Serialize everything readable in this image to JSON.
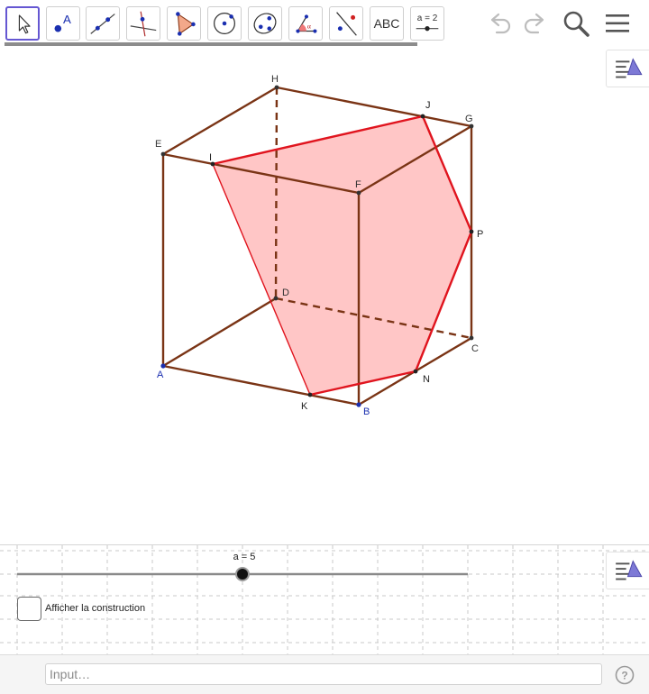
{
  "toolbar": {
    "text_tool_label": "ABC",
    "slider_tool_label": "a = 2",
    "point_tool_label": "A"
  },
  "graphics": {
    "vertices": {
      "A": "A",
      "B": "B",
      "C": "C",
      "D": "D",
      "E": "E",
      "F": "F",
      "G": "G",
      "H": "H",
      "I": "I",
      "J": "J",
      "K": "K",
      "N": "N",
      "P": "P"
    },
    "colors": {
      "cube_edges": "#7a3415",
      "section_edges": "#e0141e",
      "section_fill": "#ffbcbc",
      "base_point_label": "#1a2fb0",
      "point_label": "#222222"
    }
  },
  "graphics2": {
    "slider_label": "a = 5",
    "slider_value": 5,
    "checkbox_label": "Afficher la construction",
    "checkbox_checked": false
  },
  "inputbar": {
    "placeholder": "Input…"
  },
  "icons": [
    "move-arrow-icon",
    "point-icon",
    "line-icon",
    "perpendicular-icon",
    "polygon-icon",
    "circle-icon",
    "conic-icon",
    "angle-icon",
    "reflect-icon",
    "text-icon",
    "slider-icon",
    "undo-icon",
    "redo-icon",
    "search-icon",
    "menu-icon",
    "style-bar-icon",
    "help-icon"
  ]
}
